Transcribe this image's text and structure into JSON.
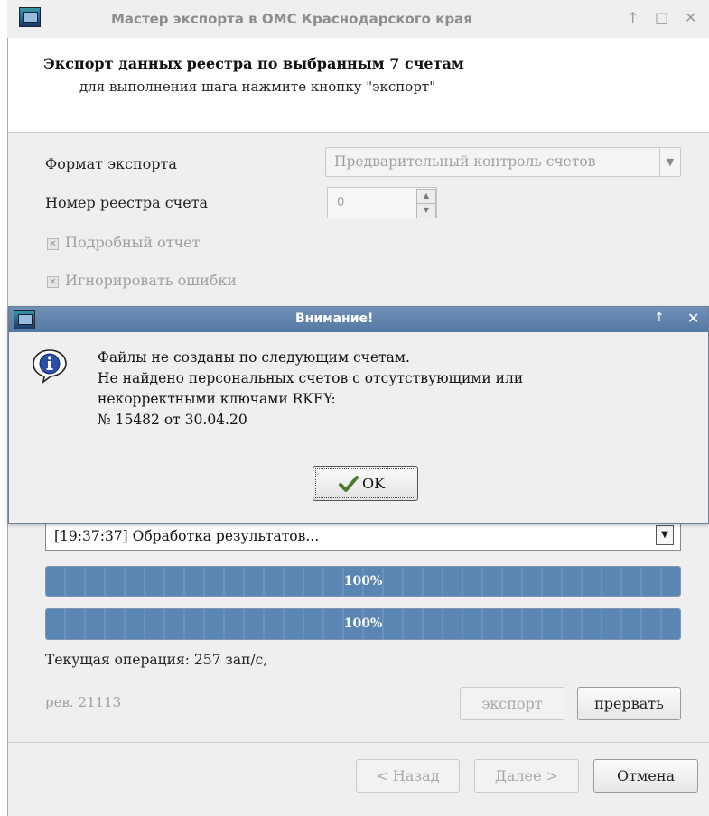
{
  "window": {
    "title": "Мастер экспорта в ОМС Краснодарского края",
    "titlebar_buttons": [
      "↑",
      "□",
      "✕"
    ]
  },
  "header": {
    "title": "Экспорт данных реестра по выбранным 7 счетам",
    "subtitle": "для выполнения шага нажмите кнопку \"экспорт\""
  },
  "form": {
    "format_label": "Формат экспорта",
    "format_value": "Предварительный контроль счетов",
    "registry_label": "Номер реестра счета",
    "registry_value": "0",
    "detailed_report_label": "Подробный отчет",
    "ignore_errors_label": "Игнорировать ошибки"
  },
  "log": {
    "selected_entry": "[19:37:37] Обработка результатов..."
  },
  "progress": [
    {
      "percent": 100,
      "label": "100%"
    },
    {
      "percent": 100,
      "label": "100%"
    }
  ],
  "status": {
    "current_operation": "Текущая операция: 257 зап/с,",
    "revision": "рев. 21113"
  },
  "actions": {
    "export_label": "экспорт",
    "abort_label": "прервать"
  },
  "nav": {
    "back_label": "< Назад",
    "next_label": "Далее >",
    "cancel_label": "Отмена"
  },
  "dialog": {
    "title": "Внимание!",
    "titlebar_buttons": [
      "↑",
      "✕"
    ],
    "lines": [
      "Файлы не созданы по следующим счетам.",
      "Не найдено персональных счетов с отсутствующими или",
      "некорректными ключами RKEY:",
      "№ 15482 от 30.04.20"
    ],
    "ok_label": "OK",
    "icon": "info-icon"
  },
  "colors": {
    "dialog_title": "#5f84b0",
    "progress_fill": "#5b86b4",
    "window_bg": "#efefef"
  }
}
